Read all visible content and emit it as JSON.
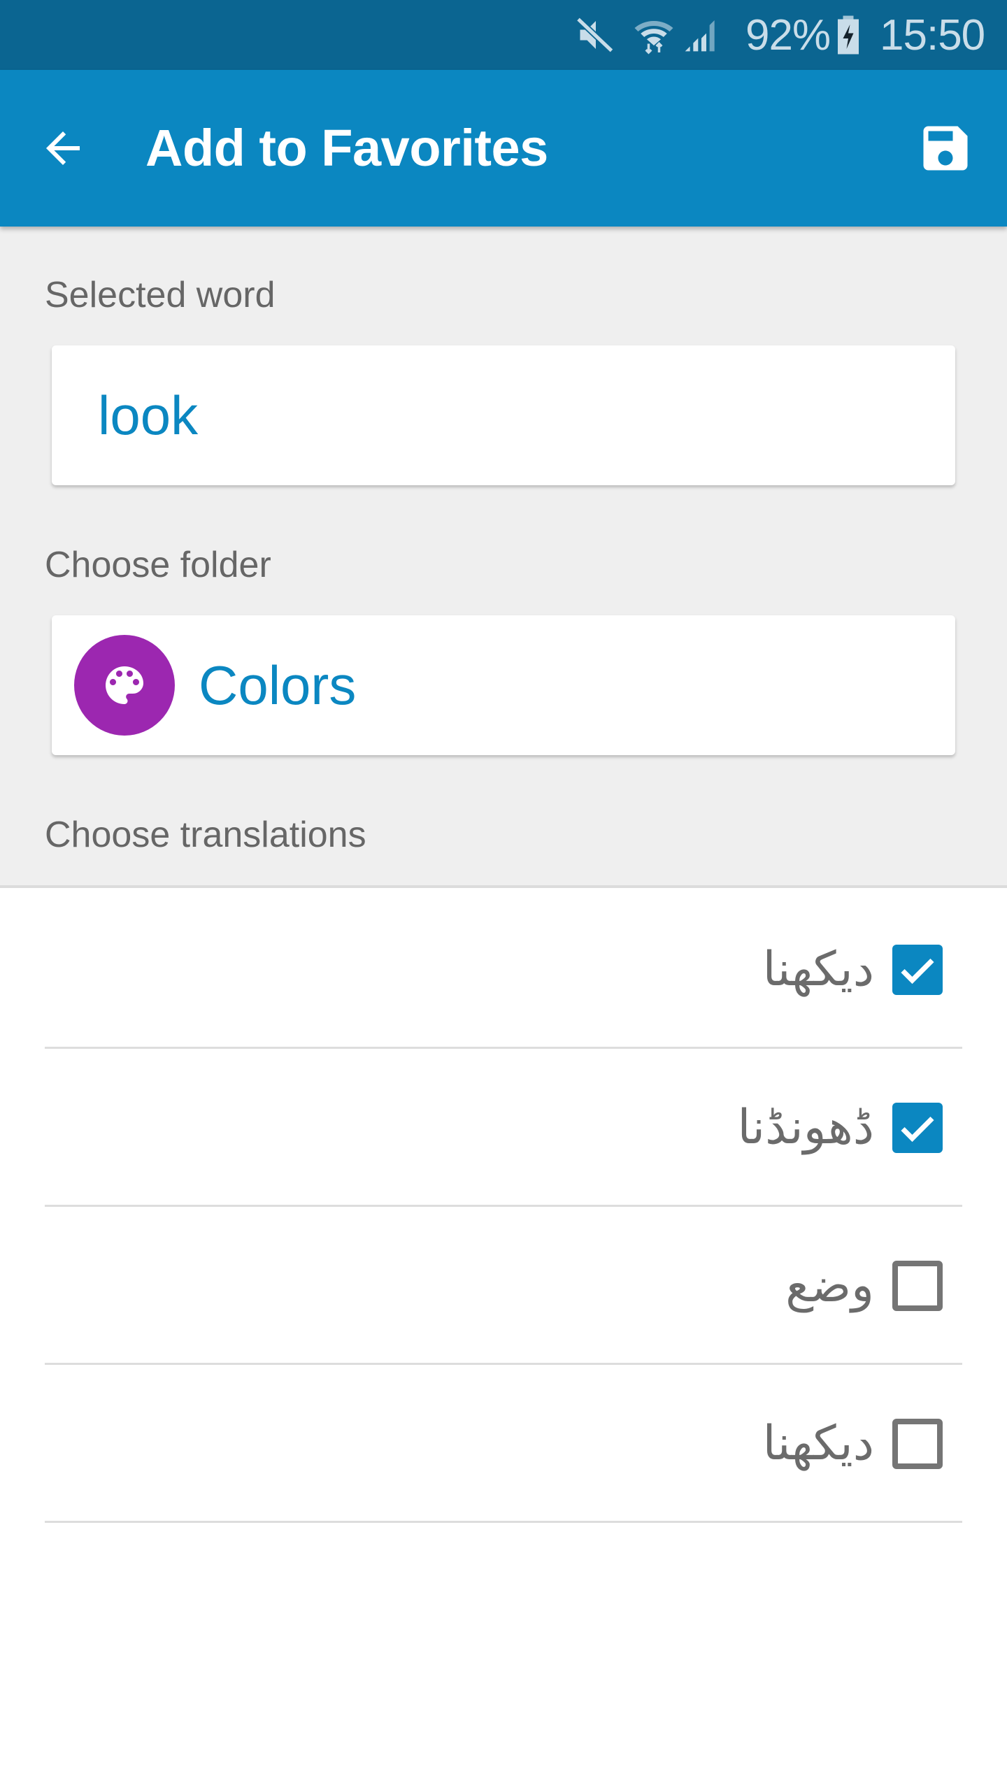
{
  "status_bar": {
    "battery_percent": "92%",
    "time": "15:50",
    "icons": [
      "mute-icon",
      "wifi-icon",
      "signal-icon",
      "battery-charging-icon"
    ]
  },
  "app_bar": {
    "title": "Add to Favorites",
    "back_icon": "arrow-back-icon",
    "save_icon": "save-icon"
  },
  "form": {
    "selected_word_label": "Selected word",
    "selected_word_value": "look",
    "choose_folder_label": "Choose folder",
    "folder": {
      "name": "Colors",
      "icon": "palette-icon",
      "icon_color": "#9c27b0"
    },
    "choose_translations_label": "Choose translations"
  },
  "translations": [
    {
      "text": "دیکھنا",
      "checked": true
    },
    {
      "text": "ڈھونڈنا",
      "checked": true
    },
    {
      "text": "وضع",
      "checked": false
    },
    {
      "text": "دیکھنا",
      "checked": false
    }
  ],
  "colors": {
    "status_bar": "#0b6591",
    "app_bar": "#0b87c1",
    "accent": "#0b87c1",
    "background": "#efefef"
  }
}
